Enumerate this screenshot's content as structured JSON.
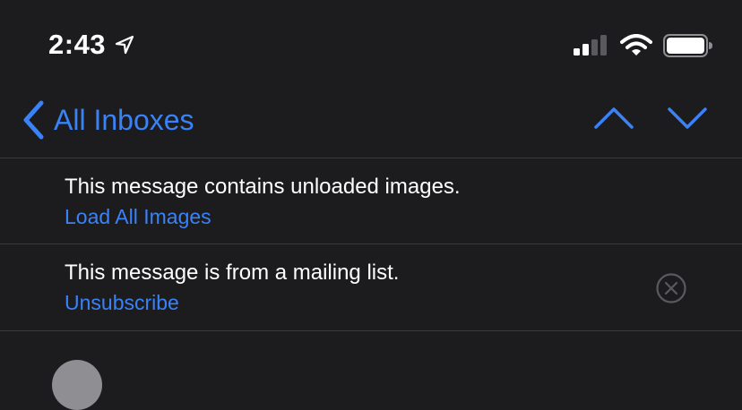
{
  "status_bar": {
    "time": "2:43",
    "icons": [
      "location-arrow-icon",
      "cellular-signal-icon",
      "wifi-icon",
      "battery-icon"
    ]
  },
  "nav": {
    "back_label": "All Inboxes",
    "prev_icon": "chevron-up-icon",
    "next_icon": "chevron-down-icon"
  },
  "banners": [
    {
      "message": "This message contains unloaded images.",
      "action": "Load All Images"
    },
    {
      "message": "This message is from a mailing list.",
      "action": "Unsubscribe",
      "dismiss_icon": "close-circle-icon"
    }
  ],
  "colors": {
    "background": "#1c1c1e",
    "accent": "#3a82f7",
    "divider": "#3a3a3c",
    "text": "#ffffff"
  }
}
